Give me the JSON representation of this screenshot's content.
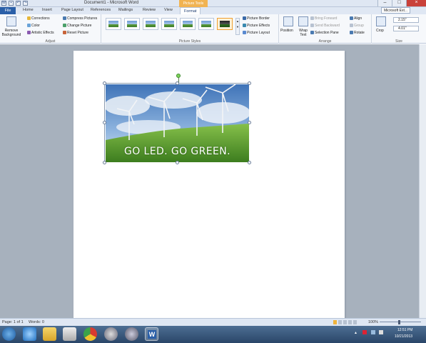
{
  "app": {
    "window_title": "Document1 - Microsoft Word",
    "contextual_tab_title": "Picture Tools",
    "account_label": "Microsoft Ext..."
  },
  "tabs": [
    {
      "label": "File",
      "name": "tab-file"
    },
    {
      "label": "Home",
      "name": "tab-home"
    },
    {
      "label": "Insert",
      "name": "tab-insert"
    },
    {
      "label": "Page Layout",
      "name": "tab-page-layout"
    },
    {
      "label": "References",
      "name": "tab-references"
    },
    {
      "label": "Mailings",
      "name": "tab-mailings"
    },
    {
      "label": "Review",
      "name": "tab-review"
    },
    {
      "label": "View",
      "name": "tab-view"
    },
    {
      "label": "Format",
      "name": "tab-format",
      "active": true
    }
  ],
  "ribbon": {
    "adjust": {
      "label": "Adjust",
      "remove_background": "Remove Background",
      "corrections": "Corrections",
      "color": "Color",
      "artistic_effects": "Artistic Effects",
      "compress_pictures": "Compress Pictures",
      "change_picture": "Change Picture",
      "reset_picture": "Reset Picture"
    },
    "picture_styles": {
      "label": "Picture Styles",
      "picture_border": "Picture Border",
      "picture_effects": "Picture Effects",
      "picture_layout": "Picture Layout"
    },
    "arrange": {
      "label": "Arrange",
      "position": "Position",
      "wrap_text": "Wrap Text",
      "bring_forward": "Bring Forward",
      "send_backward": "Send Backward",
      "selection_pane": "Selection Pane",
      "align": "Align",
      "group": "Group",
      "rotate": "Rotate"
    },
    "size": {
      "label": "Size",
      "crop": "Crop",
      "height": "2.15\"",
      "width": "4.01\""
    }
  },
  "document": {
    "picture_caption": "GO LED. GO GREEN."
  },
  "status": {
    "page": "Page: 1 of 1",
    "words": "Words: 0",
    "zoom": "100%"
  },
  "taskbar": {
    "time": "12:51 PM",
    "date": "10/21/2013"
  },
  "colors": {
    "ribbon_accent": "#2a5fa8",
    "contextual_tab": "#f1b352",
    "taskbar": "#2a4668"
  }
}
